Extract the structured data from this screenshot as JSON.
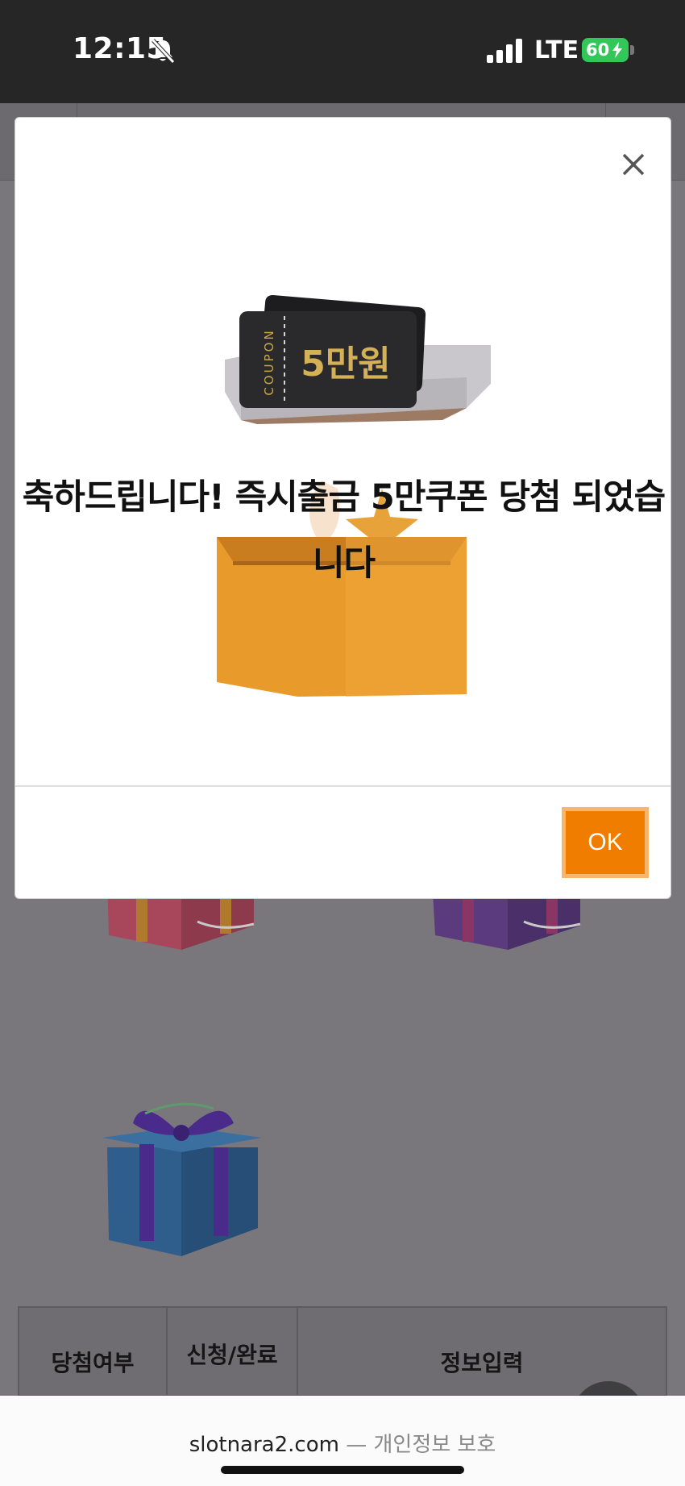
{
  "status_bar": {
    "time": "12:15",
    "network": "LTE",
    "battery": "60",
    "icons": [
      "bell-slash-icon",
      "signal-icon",
      "battery-charging-icon"
    ]
  },
  "modal": {
    "message": "축하드립니다! 즉시출금 5만쿠폰 당첨 되었습니다",
    "ok_label": "OK",
    "close_icon": "close-icon",
    "coupon": {
      "label": "COUPON",
      "amount": "5만원"
    }
  },
  "background": {
    "table_headers": [
      "당첨여부",
      "신청/완료",
      "정보입력"
    ]
  },
  "url_bar": {
    "domain": "slotnara2.com",
    "separator": "—",
    "note": "개인정보 보호"
  },
  "colors": {
    "accent": "#f07d00",
    "status_bar": "#262626",
    "overlay": "#7a777c"
  }
}
